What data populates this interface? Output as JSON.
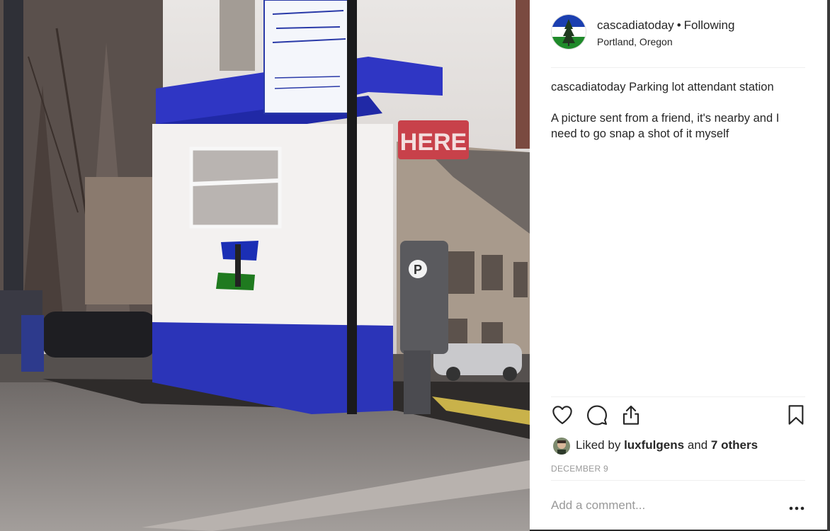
{
  "post": {
    "username": "cascadiatoday",
    "separator": "•",
    "follow_status": "Following",
    "location": "Portland, Oregon",
    "caption_user": "cascadiatoday",
    "caption_line1": "Parking lot attendant station",
    "caption_line2": "A picture sent from a friend, it's nearby and I need to go snap a shot of it myself",
    "likes": {
      "prefix": "Liked by",
      "user": "luxfulgens",
      "and": "and",
      "others": "7 others"
    },
    "date": "DECEMBER 9",
    "comment_placeholder": "Add a comment..."
  },
  "photo": {
    "sign_text": "HERE"
  },
  "icons": {
    "like": "heart-icon",
    "comment": "speech-bubble-icon",
    "share": "share-icon",
    "save": "bookmark-icon",
    "more": "more-options-icon"
  },
  "colors": {
    "text": "#262626",
    "muted": "#999999",
    "flag_blue": "#1b2fb5",
    "flag_green": "#1f7a1f"
  }
}
